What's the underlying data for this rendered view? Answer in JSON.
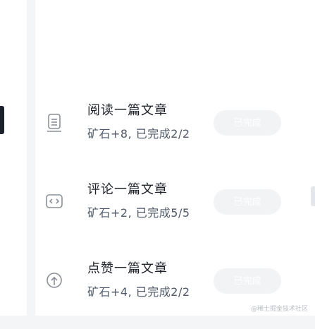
{
  "tasks": [
    {
      "icon": "document-icon",
      "title": "阅读一篇文章",
      "description": "矿石+8, 已完成2/2",
      "button": "已完成"
    },
    {
      "icon": "code-icon",
      "title": "评论一篇文章",
      "description": "矿石+2, 已完成5/5",
      "button": "已完成"
    },
    {
      "icon": "like-icon",
      "title": "点赞一篇文章",
      "description": "矿石+4, 已完成2/2",
      "button": "已完成"
    }
  ],
  "watermark": "@稀土掘金技术社区",
  "colors": {
    "icon": "#8a8f99",
    "title": "#1d2129",
    "description": "#4e5969",
    "button_bg": "#f2f3f5"
  }
}
